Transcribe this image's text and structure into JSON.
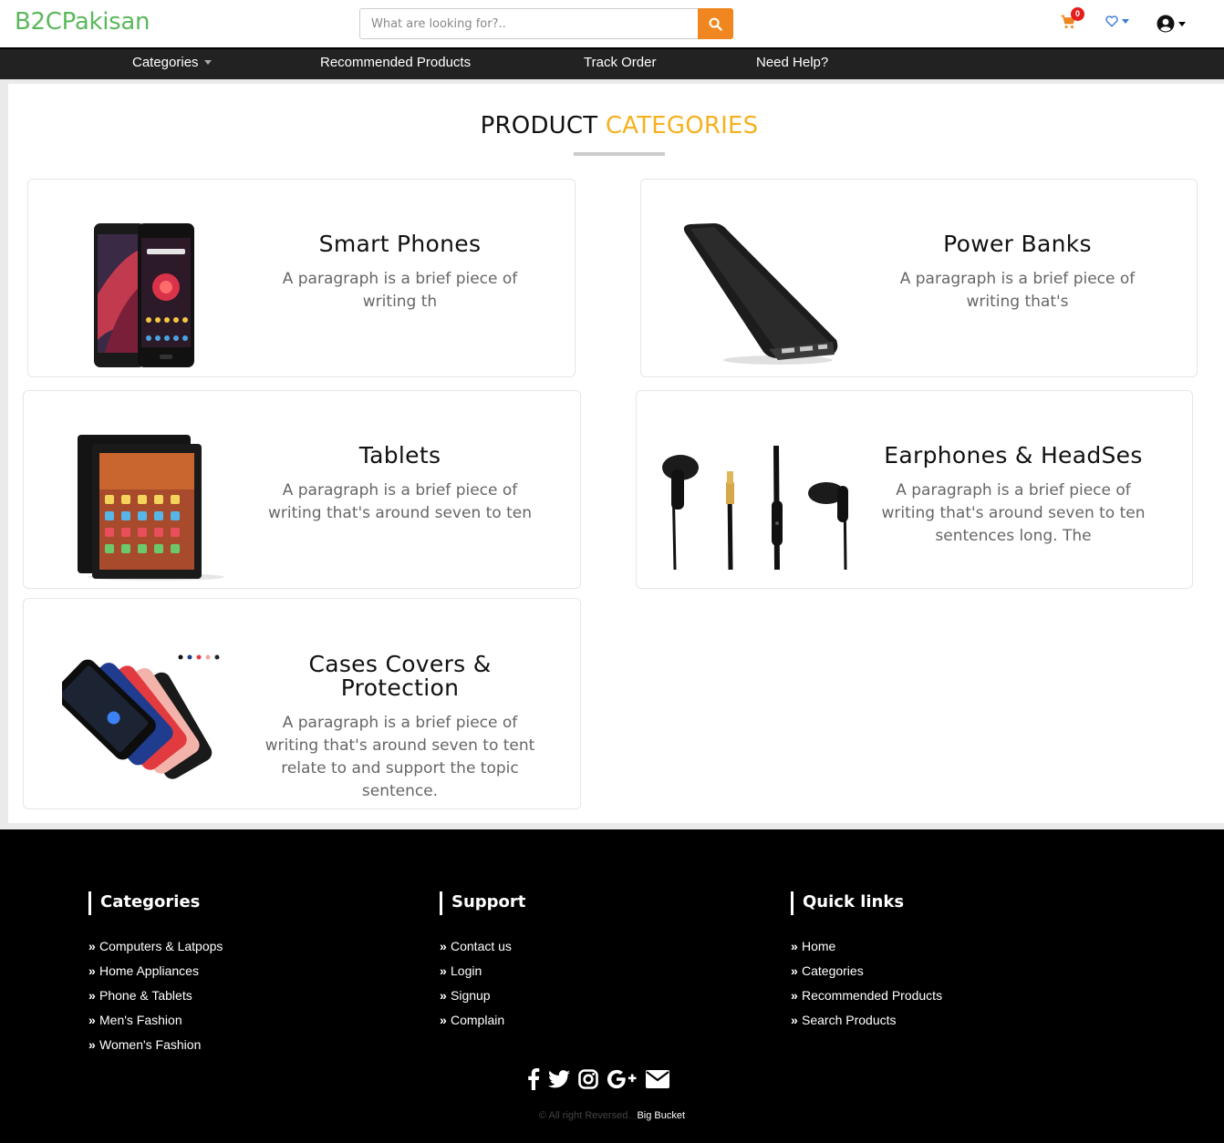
{
  "header": {
    "logo": "B2CPakisan",
    "search_placeholder": "What are looking for?..",
    "cart_count": "0",
    "colors": {
      "brand": "#5cb85c",
      "search_button": "#f0861f",
      "badge": "#e61d1d"
    }
  },
  "nav": {
    "items": [
      {
        "label": "Categories"
      },
      {
        "label": "Recommended Products"
      },
      {
        "label": "Track Order"
      },
      {
        "label": "Need Help?"
      }
    ]
  },
  "main": {
    "heading_plain": "PRODUCT",
    "heading_accent": "CATEGORIES",
    "accent_color": "#f5b120",
    "categories": [
      {
        "title": "Smart Phones",
        "desc": "A paragraph is a brief piece of writing th",
        "image": "smartphones-image"
      },
      {
        "title": "Power Banks",
        "desc": "A paragraph is a brief piece of writing that's",
        "image": "powerbank-image"
      },
      {
        "title": "Tablets",
        "desc": "A paragraph is a brief piece of writing that's around seven to ten",
        "image": "tablet-image"
      },
      {
        "title": "Earphones & HeadSes",
        "desc": "A paragraph is a brief piece of writing that's around seven to ten sentences long. The",
        "image": "earphones-image"
      },
      {
        "title": "Cases Covers & Protection",
        "desc": "A paragraph is a brief piece of writing that's around seven to tent relate to and support the topic sentence.",
        "image": "phone-cases-image"
      }
    ]
  },
  "footer": {
    "columns": [
      {
        "heading": "Categories",
        "links": [
          "Computers & Latpops",
          "Home Appliances",
          "Phone & Tablets",
          "Men's Fashion",
          "Women's Fashion"
        ]
      },
      {
        "heading": "Support",
        "links": [
          "Contact us",
          "Login",
          "Signup",
          "Complain"
        ]
      },
      {
        "heading": "Quick links",
        "links": [
          "Home",
          "Categories",
          "Recommended Products",
          "Search Products"
        ]
      }
    ],
    "social_icons": [
      "facebook-icon",
      "twitter-icon",
      "instagram-icon",
      "google-plus-icon",
      "envelope-icon"
    ],
    "copyright": "© All right Reversed.",
    "copyright_brand": "Big Bucket"
  }
}
